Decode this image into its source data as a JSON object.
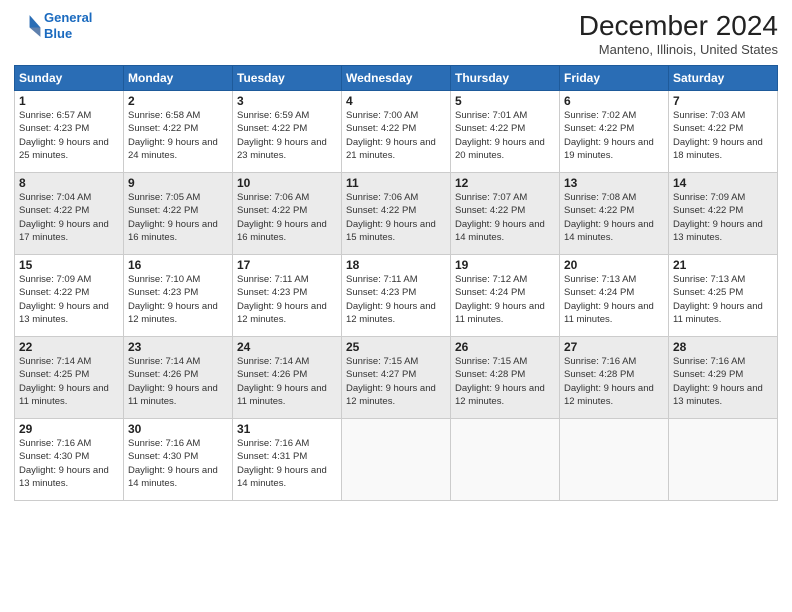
{
  "logo": {
    "line1": "General",
    "line2": "Blue"
  },
  "title": "December 2024",
  "location": "Manteno, Illinois, United States",
  "days_header": [
    "Sunday",
    "Monday",
    "Tuesday",
    "Wednesday",
    "Thursday",
    "Friday",
    "Saturday"
  ],
  "weeks": [
    [
      {
        "day": "1",
        "sunrise": "6:57 AM",
        "sunset": "4:23 PM",
        "daylight": "9 hours and 25 minutes."
      },
      {
        "day": "2",
        "sunrise": "6:58 AM",
        "sunset": "4:22 PM",
        "daylight": "9 hours and 24 minutes."
      },
      {
        "day": "3",
        "sunrise": "6:59 AM",
        "sunset": "4:22 PM",
        "daylight": "9 hours and 23 minutes."
      },
      {
        "day": "4",
        "sunrise": "7:00 AM",
        "sunset": "4:22 PM",
        "daylight": "9 hours and 21 minutes."
      },
      {
        "day": "5",
        "sunrise": "7:01 AM",
        "sunset": "4:22 PM",
        "daylight": "9 hours and 20 minutes."
      },
      {
        "day": "6",
        "sunrise": "7:02 AM",
        "sunset": "4:22 PM",
        "daylight": "9 hours and 19 minutes."
      },
      {
        "day": "7",
        "sunrise": "7:03 AM",
        "sunset": "4:22 PM",
        "daylight": "9 hours and 18 minutes."
      }
    ],
    [
      {
        "day": "8",
        "sunrise": "7:04 AM",
        "sunset": "4:22 PM",
        "daylight": "9 hours and 17 minutes."
      },
      {
        "day": "9",
        "sunrise": "7:05 AM",
        "sunset": "4:22 PM",
        "daylight": "9 hours and 16 minutes."
      },
      {
        "day": "10",
        "sunrise": "7:06 AM",
        "sunset": "4:22 PM",
        "daylight": "9 hours and 16 minutes."
      },
      {
        "day": "11",
        "sunrise": "7:06 AM",
        "sunset": "4:22 PM",
        "daylight": "9 hours and 15 minutes."
      },
      {
        "day": "12",
        "sunrise": "7:07 AM",
        "sunset": "4:22 PM",
        "daylight": "9 hours and 14 minutes."
      },
      {
        "day": "13",
        "sunrise": "7:08 AM",
        "sunset": "4:22 PM",
        "daylight": "9 hours and 14 minutes."
      },
      {
        "day": "14",
        "sunrise": "7:09 AM",
        "sunset": "4:22 PM",
        "daylight": "9 hours and 13 minutes."
      }
    ],
    [
      {
        "day": "15",
        "sunrise": "7:09 AM",
        "sunset": "4:22 PM",
        "daylight": "9 hours and 13 minutes."
      },
      {
        "day": "16",
        "sunrise": "7:10 AM",
        "sunset": "4:23 PM",
        "daylight": "9 hours and 12 minutes."
      },
      {
        "day": "17",
        "sunrise": "7:11 AM",
        "sunset": "4:23 PM",
        "daylight": "9 hours and 12 minutes."
      },
      {
        "day": "18",
        "sunrise": "7:11 AM",
        "sunset": "4:23 PM",
        "daylight": "9 hours and 12 minutes."
      },
      {
        "day": "19",
        "sunrise": "7:12 AM",
        "sunset": "4:24 PM",
        "daylight": "9 hours and 11 minutes."
      },
      {
        "day": "20",
        "sunrise": "7:13 AM",
        "sunset": "4:24 PM",
        "daylight": "9 hours and 11 minutes."
      },
      {
        "day": "21",
        "sunrise": "7:13 AM",
        "sunset": "4:25 PM",
        "daylight": "9 hours and 11 minutes."
      }
    ],
    [
      {
        "day": "22",
        "sunrise": "7:14 AM",
        "sunset": "4:25 PM",
        "daylight": "9 hours and 11 minutes."
      },
      {
        "day": "23",
        "sunrise": "7:14 AM",
        "sunset": "4:26 PM",
        "daylight": "9 hours and 11 minutes."
      },
      {
        "day": "24",
        "sunrise": "7:14 AM",
        "sunset": "4:26 PM",
        "daylight": "9 hours and 11 minutes."
      },
      {
        "day": "25",
        "sunrise": "7:15 AM",
        "sunset": "4:27 PM",
        "daylight": "9 hours and 12 minutes."
      },
      {
        "day": "26",
        "sunrise": "7:15 AM",
        "sunset": "4:28 PM",
        "daylight": "9 hours and 12 minutes."
      },
      {
        "day": "27",
        "sunrise": "7:16 AM",
        "sunset": "4:28 PM",
        "daylight": "9 hours and 12 minutes."
      },
      {
        "day": "28",
        "sunrise": "7:16 AM",
        "sunset": "4:29 PM",
        "daylight": "9 hours and 13 minutes."
      }
    ],
    [
      {
        "day": "29",
        "sunrise": "7:16 AM",
        "sunset": "4:30 PM",
        "daylight": "9 hours and 13 minutes."
      },
      {
        "day": "30",
        "sunrise": "7:16 AM",
        "sunset": "4:30 PM",
        "daylight": "9 hours and 14 minutes."
      },
      {
        "day": "31",
        "sunrise": "7:16 AM",
        "sunset": "4:31 PM",
        "daylight": "9 hours and 14 minutes."
      },
      null,
      null,
      null,
      null
    ]
  ]
}
